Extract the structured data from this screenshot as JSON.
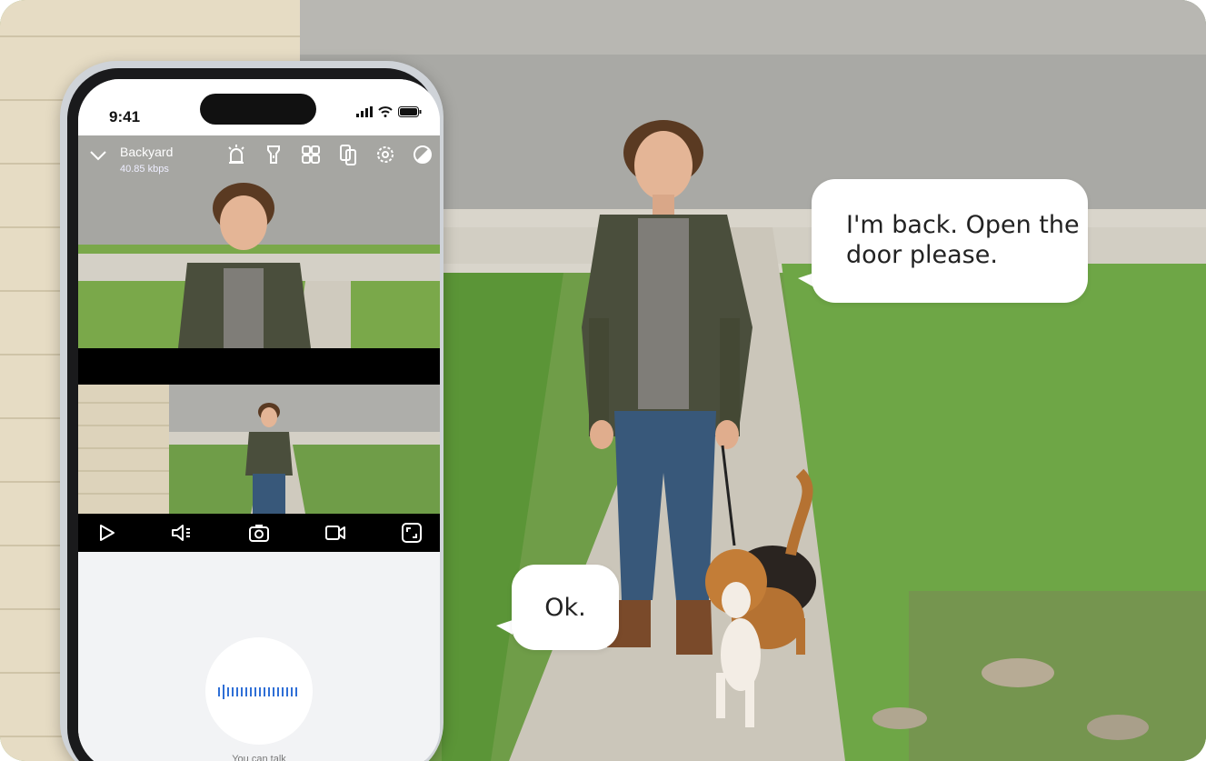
{
  "status_bar": {
    "time": "9:41"
  },
  "camera": {
    "name": "Backyard",
    "bitrate": "40.85 kbps"
  },
  "header_icons": [
    "alarm-icon",
    "flashlight-icon",
    "grid-icon",
    "phone-swap-icon",
    "settings-icon",
    "contrast-icon"
  ],
  "controls": [
    "play-icon",
    "speaker-icon",
    "snapshot-icon",
    "record-video-icon",
    "fullscreen-icon"
  ],
  "talk": {
    "label": "You can talk"
  },
  "speech": {
    "person": "I'm back. Open the door please.",
    "reply": "Ok."
  },
  "colors": {
    "accent": "#2f6fd6",
    "lawn": "#5f9a3a",
    "sidewalk": "#c9c4b8"
  }
}
